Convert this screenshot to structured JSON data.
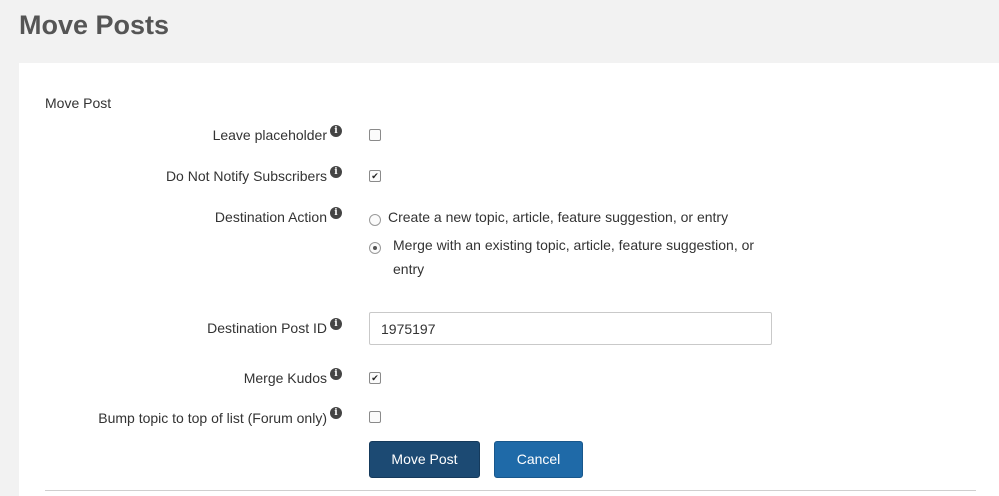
{
  "page": {
    "title": "Move Posts"
  },
  "form": {
    "section_title": "Move Post",
    "leave_placeholder": {
      "label": "Leave placeholder",
      "checked": false
    },
    "do_not_notify": {
      "label": "Do Not Notify Subscribers",
      "checked": true
    },
    "destination_action": {
      "label": "Destination Action",
      "options": [
        {
          "label": "Create a new topic, article, feature suggestion, or entry",
          "selected": false
        },
        {
          "label": "Merge with an existing topic, article, feature suggestion, or entry",
          "selected": true
        }
      ]
    },
    "destination_post_id": {
      "label": "Destination Post ID",
      "value": "1975197"
    },
    "merge_kudos": {
      "label": "Merge Kudos",
      "checked": true
    },
    "bump_topic": {
      "label": "Bump topic to top of list (Forum only)",
      "checked": false
    },
    "buttons": {
      "submit": "Move Post",
      "cancel": "Cancel"
    },
    "info_icon_glyph": "i",
    "check_glyph": "✔"
  },
  "colors": {
    "primary_button": "#1c4a73",
    "secondary_button": "#1f6aa8"
  }
}
